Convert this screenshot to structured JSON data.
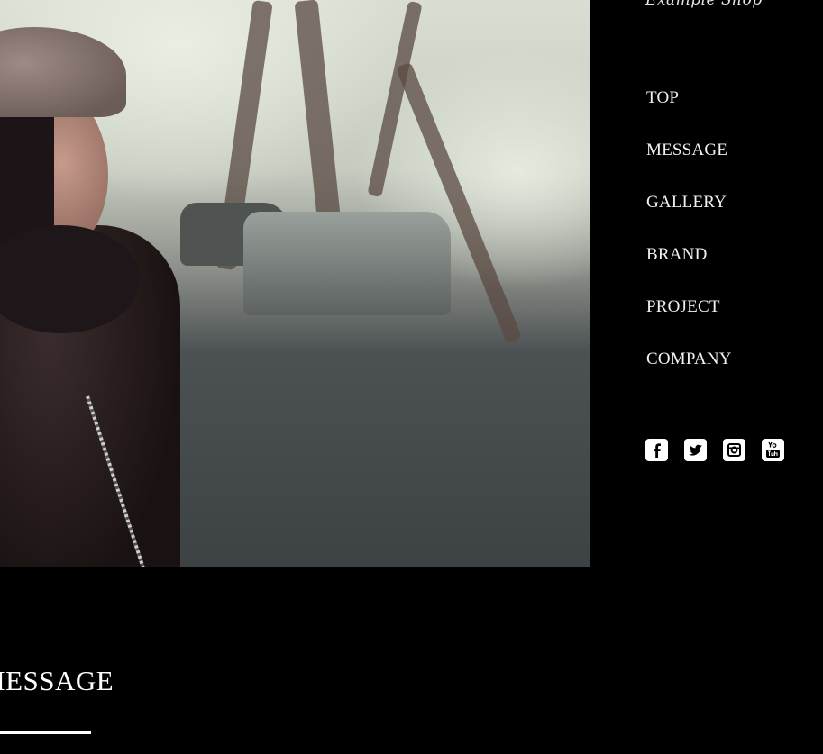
{
  "brand": {
    "logo_text": "Example Shop"
  },
  "nav": {
    "items": [
      {
        "label": "TOP"
      },
      {
        "label": "MESSAGE"
      },
      {
        "label": "GALLERY"
      },
      {
        "label": "BRAND"
      },
      {
        "label": "PROJECT"
      },
      {
        "label": "COMPANY"
      }
    ]
  },
  "social": {
    "icons": [
      "facebook-icon",
      "twitter-icon",
      "instagram-icon",
      "youtube-icon"
    ]
  },
  "hero": {
    "alt": "woman in cap on street"
  },
  "section": {
    "title": "MESSAGE"
  },
  "colors": {
    "background": "#000000",
    "text": "#ffffff"
  }
}
